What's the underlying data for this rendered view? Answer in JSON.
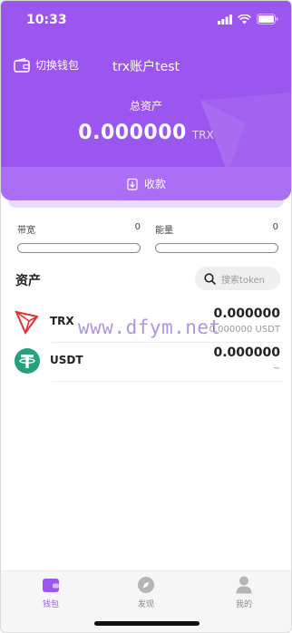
{
  "status_bar": {
    "time": "10:33"
  },
  "header": {
    "switch_wallet_label": "切换钱包",
    "wallet_title": "trx账户test",
    "total_label": "总资产",
    "total_value": "0.000000",
    "total_unit": "TRX",
    "receive_label": "收款"
  },
  "resources": {
    "bandwidth": {
      "label": "带宽",
      "value": "0",
      "fraction": 0
    },
    "energy": {
      "label": "能量",
      "value": "0",
      "fraction": 0
    }
  },
  "assets": {
    "title": "资产",
    "search_placeholder": "搜索token",
    "tokens": [
      {
        "symbol": "TRX",
        "amount": "0.000000",
        "sub": "0.000000 USDT"
      },
      {
        "symbol": "USDT",
        "amount": "0.000000",
        "sub": "~"
      }
    ]
  },
  "watermark": "www.dfym.net",
  "tabbar": {
    "wallet": "钱包",
    "discover": "发现",
    "mine": "我的"
  },
  "colors": {
    "primary": "#9b56ef",
    "trx_red": "#e6312f",
    "usdt_green": "#26a17b"
  }
}
